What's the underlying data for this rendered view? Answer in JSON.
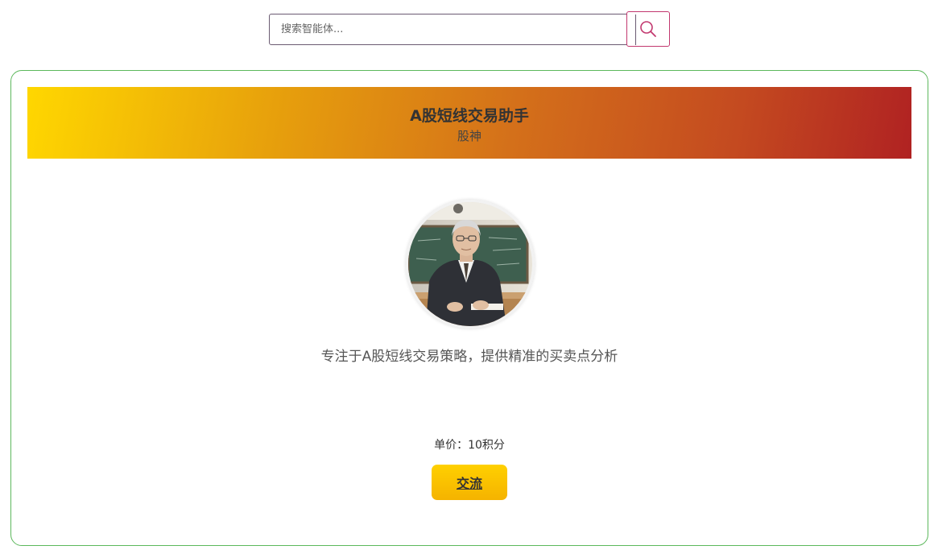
{
  "search": {
    "placeholder": "搜索智能体..."
  },
  "agent": {
    "title": "A股短线交易助手",
    "subtitle": "股神",
    "description": "专注于A股短线交易策略，提供精准的买卖点分析",
    "price": "单价：10积分",
    "chat_label": "交流"
  },
  "colors": {
    "card_border": "#5cb85c",
    "search_button_border": "#c2386f",
    "banner_start": "#ffd700",
    "banner_end": "#b02222",
    "button": "#ffc800"
  },
  "icons": {
    "search": "search-icon",
    "avatar": "avatar"
  }
}
